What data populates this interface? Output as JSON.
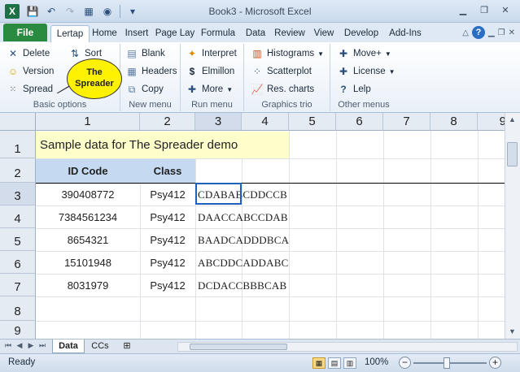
{
  "window": {
    "app_icon": "X",
    "title": "Book3 - Microsoft Excel"
  },
  "ribbon_tabs": {
    "file": "File",
    "items": [
      "Lertap",
      "Home",
      "Insert",
      "Page Lay",
      "Formula",
      "Data",
      "Review",
      "View",
      "Develop",
      "Add-Ins"
    ],
    "active": "Lertap"
  },
  "groups": {
    "basic": {
      "label": "Basic options",
      "delete": "Delete",
      "version": "Version",
      "spread": "Spread",
      "sort": "Sort"
    },
    "newmenu": {
      "label": "New menu",
      "blank": "Blank",
      "headers": "Headers",
      "copy": "Copy"
    },
    "runmenu": {
      "label": "Run menu",
      "interpret": "Interpret",
      "elmillon": "Elmillon",
      "more": "More"
    },
    "graphics": {
      "label": "Graphics trio",
      "histograms": "Histograms",
      "scatterplot": "Scatterplot",
      "rescharts": "Res. charts"
    },
    "other": {
      "label": "Other menus",
      "moveplus": "Move+",
      "license": "License",
      "lelp": "Lelp"
    }
  },
  "callout": {
    "line1": "The",
    "line2": "Spreader"
  },
  "sheet": {
    "columns": [
      "1",
      "2",
      "3",
      "4",
      "5",
      "6",
      "7",
      "8",
      "9"
    ],
    "rows": [
      "1",
      "2",
      "3",
      "4",
      "5",
      "6",
      "7",
      "8",
      "9"
    ],
    "title": "Sample data for The Spreader demo",
    "headers": {
      "id": "ID Code",
      "class": "Class"
    },
    "records": [
      {
        "id": "390408772",
        "class": "Psy412",
        "resp": "CDABABCDDCCB"
      },
      {
        "id": "7384561234",
        "class": "Psy412",
        "resp": "DAACCABCCDAB"
      },
      {
        "id": "8654321",
        "class": "Psy412",
        "resp": "BAADCADDDBCA"
      },
      {
        "id": "15101948",
        "class": "Psy412",
        "resp": "ABCDDCADDABC"
      },
      {
        "id": "8031979",
        "class": "Psy412",
        "resp": "DCDACCBBBCAB"
      }
    ]
  },
  "sheet_tabs": [
    "Data",
    "CCs"
  ],
  "active_sheet": "Data",
  "status": {
    "text": "Ready",
    "zoom": "100%"
  }
}
